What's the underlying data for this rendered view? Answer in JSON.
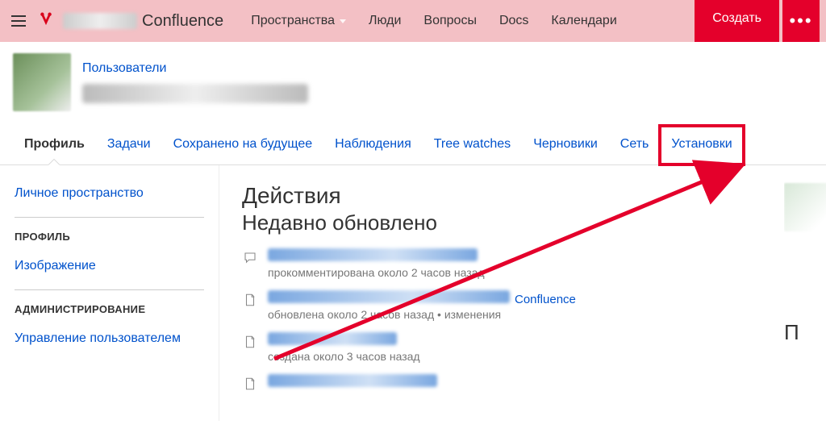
{
  "top": {
    "title_suffix": "Confluence",
    "links": {
      "spaces": "Пространства",
      "people": "Люди",
      "questions": "Вопросы",
      "docs": "Docs",
      "calendars": "Календари"
    },
    "create": "Создать"
  },
  "profile": {
    "breadcrumb": "Пользователи"
  },
  "tabs": {
    "profile": "Профиль",
    "tasks": "Задачи",
    "saved": "Сохранено на будущее",
    "watches": "Наблюдения",
    "tree_watches": "Tree watches",
    "drafts": "Черновики",
    "network": "Сеть",
    "settings": "Установки"
  },
  "left_nav": {
    "personal_space": "Личное пространство",
    "profile_head": "ПРОФИЛЬ",
    "picture": "Изображение",
    "admin_head": "АДМИНИСТРИРОВАНИЕ",
    "user_mgmt": "Управление пользователем"
  },
  "main": {
    "actions": "Действия",
    "recently_updated": "Недавно обновлено",
    "feed": [
      {
        "kind": "comment",
        "suffix": "",
        "meta": "прокомментирована около 2 часов назад",
        "meta2": ""
      },
      {
        "kind": "page",
        "suffix": "Confluence",
        "meta": "обновлена около 2 часов назад",
        "meta2": "изменения"
      },
      {
        "kind": "page",
        "suffix": "",
        "meta": "создана около 3 часов назад",
        "meta2": ""
      },
      {
        "kind": "page",
        "suffix": "",
        "meta": "",
        "meta2": ""
      }
    ]
  },
  "right": {
    "letter": "П"
  }
}
